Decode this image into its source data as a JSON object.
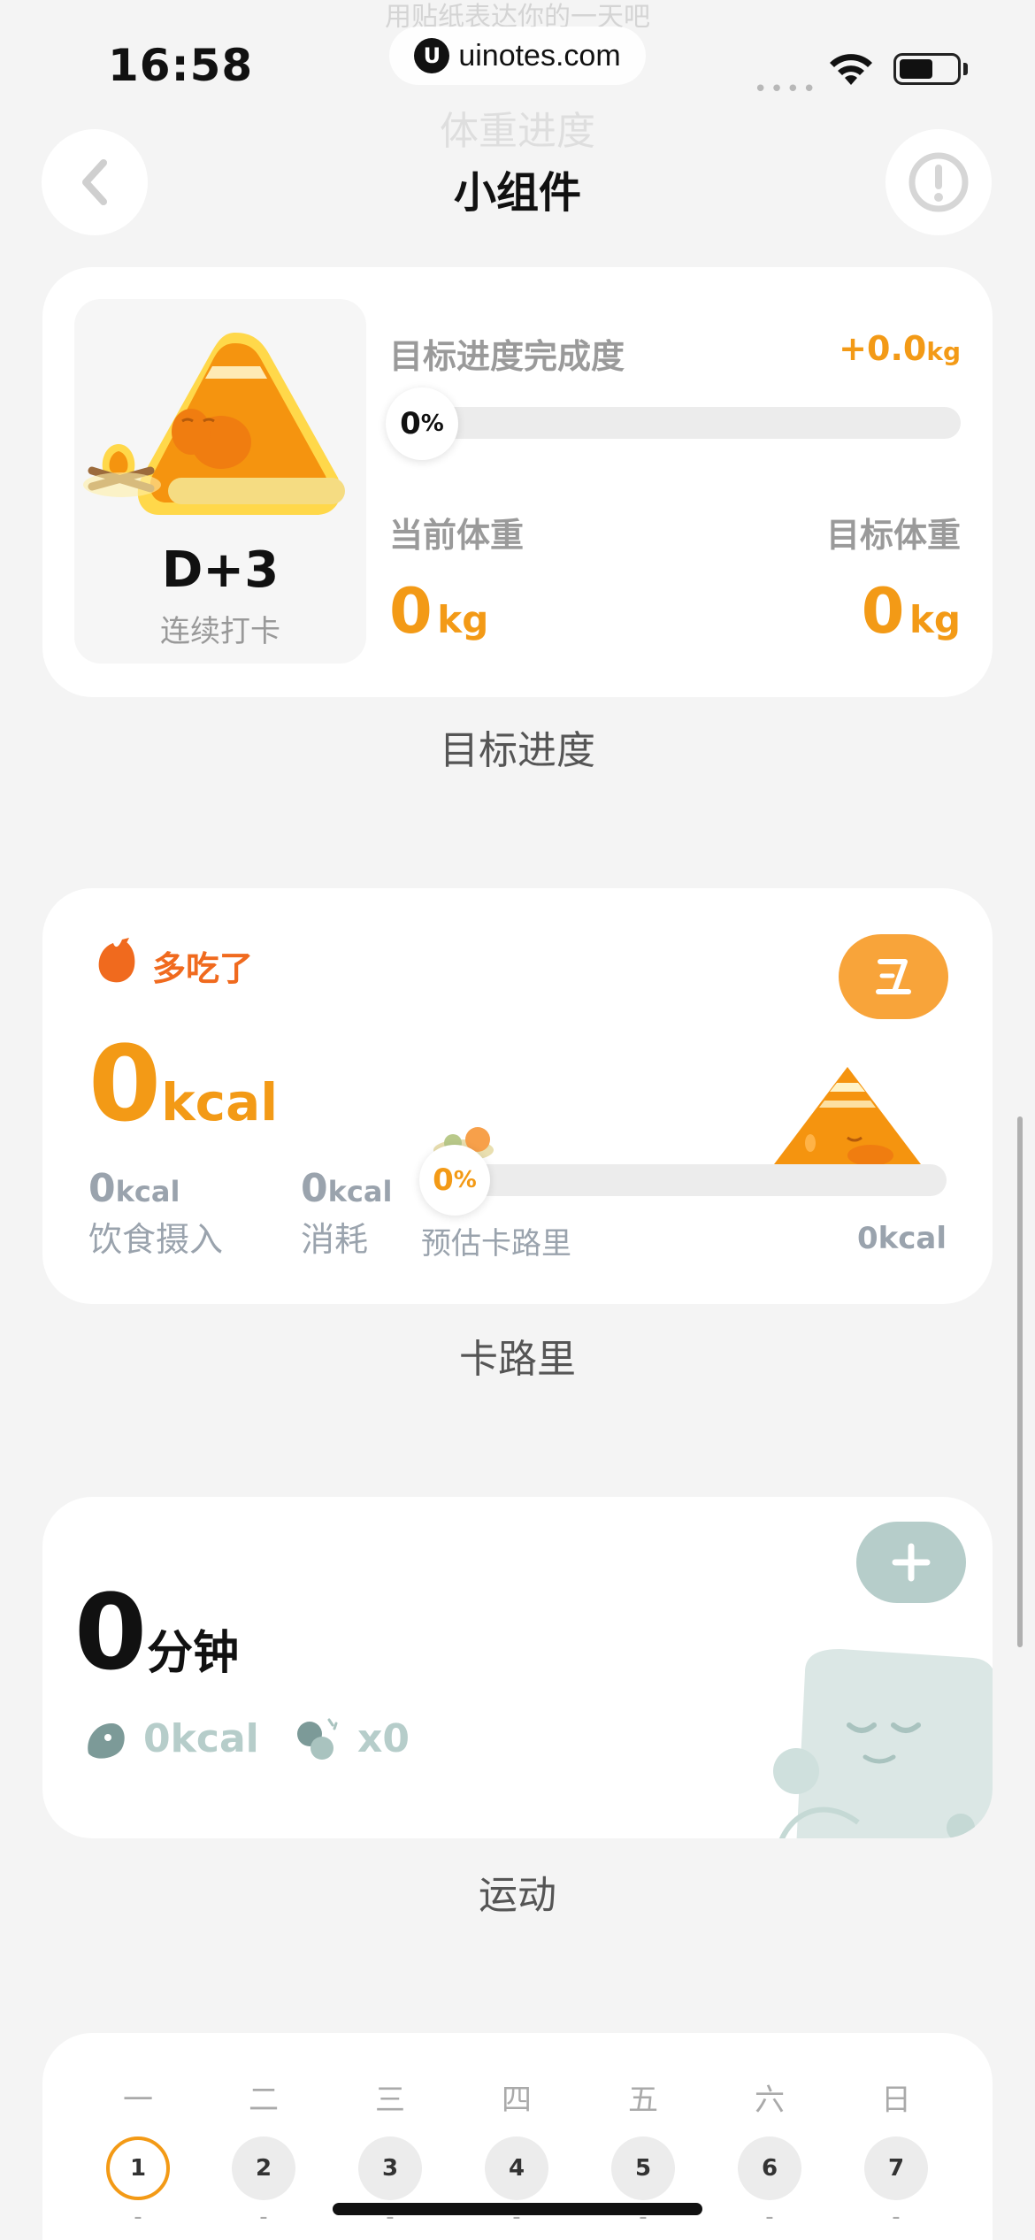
{
  "status_bar": {
    "time": "16:58",
    "url": "uinotes.com"
  },
  "ghost_text": {
    "line1": "用贴纸表达你的一天吧",
    "line2": "体重进度"
  },
  "header": {
    "title": "小组件"
  },
  "weight_widget": {
    "goal_label": "目标进度完成度",
    "goal_delta": "+0.0",
    "goal_delta_unit": "kg",
    "progress_value": "0",
    "progress_unit": "%",
    "progress_fraction": 0,
    "current_label": "当前体重",
    "current_value": "0",
    "target_label": "目标体重",
    "target_value": "0",
    "unit": "kg",
    "streak": "D+3",
    "streak_label": "连续打卡",
    "caption": "目标进度"
  },
  "calorie_widget": {
    "status": "多吃了",
    "total_value": "0",
    "total_unit": "kcal",
    "intake_value": "0",
    "intake_unit": "kcal",
    "intake_label": "饮食摄入",
    "burn_value": "0",
    "burn_unit": "kcal",
    "burn_label": "消耗",
    "progress_value": "0",
    "progress_unit": "%",
    "progress_fraction": 0,
    "estimate_label": "预估卡路里",
    "estimate_value": "0kcal",
    "caption": "卡路里"
  },
  "exercise_widget": {
    "minutes_value": "0",
    "minutes_unit": "分钟",
    "kcal_value": "0kcal",
    "count_value": "x0",
    "caption": "运动"
  },
  "week_widget": {
    "days": [
      {
        "label": "一",
        "num": "1",
        "dash": "-"
      },
      {
        "label": "二",
        "num": "2",
        "dash": "-"
      },
      {
        "label": "三",
        "num": "3",
        "dash": "-"
      },
      {
        "label": "四",
        "num": "4",
        "dash": "-"
      },
      {
        "label": "五",
        "num": "5",
        "dash": "-"
      },
      {
        "label": "六",
        "num": "6",
        "dash": "-"
      },
      {
        "label": "日",
        "num": "7",
        "dash": "-"
      }
    ]
  },
  "colors": {
    "accent": "#f39a16",
    "accent_red": "#f06a1e",
    "mint": "#b6cdca",
    "background": "#f4f4f4"
  }
}
